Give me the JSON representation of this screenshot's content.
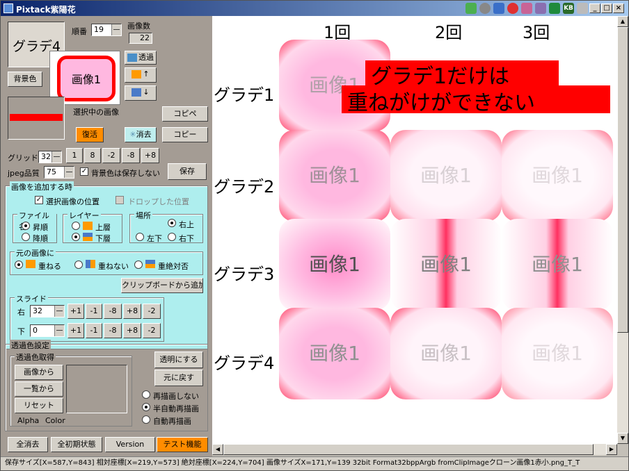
{
  "window": {
    "title": "Pixtack紫陽花"
  },
  "top": {
    "preview_name": "グラデ4",
    "order_label": "順番",
    "order_value": "19",
    "count_label": "画像数",
    "count_value": "22",
    "selected_image": "画像1",
    "transparent_btn": "透過",
    "bg_color_btn": "背景色",
    "selected_caption": "選択中の画像",
    "restore_btn": "復活",
    "erase_btn": "消去",
    "copy_paste_btn": "コピペ",
    "copy_btn": "コピー"
  },
  "grid": {
    "label": "グリッド",
    "value": "32",
    "buttons": [
      "1",
      "8",
      "-2",
      "-8",
      "+8"
    ]
  },
  "jpeg": {
    "label": "jpeg品質",
    "value": "75",
    "bg_nosave_label": "背景色は保存しない",
    "save_btn": "保存"
  },
  "add_panel": {
    "title": "画像を追加する時",
    "selected_pos_label": "選択画像の位置",
    "drop_pos_label": "ドロップした位置",
    "filename": {
      "title": "ファイル名",
      "asc": "昇順",
      "desc": "降順"
    },
    "layer": {
      "title": "レイヤー",
      "top": "上層",
      "bottom": "下層"
    },
    "place": {
      "title": "場所",
      "top_right": "右上",
      "bottom_left": "左下",
      "bottom_right": "右下"
    },
    "original": {
      "title": "元の画像に",
      "overlap": "重ねる",
      "no_overlap": "重ねない",
      "never": "重絶対否"
    },
    "clipboard_btn": "クリップボードから追加",
    "slide": {
      "title": "スライド",
      "right_label": "右",
      "right_value": "32",
      "down_label": "下",
      "down_value": "0",
      "buttons": [
        "+1",
        "-1",
        "-8",
        "+8",
        "-2"
      ]
    }
  },
  "trans_panel": {
    "title": "透過色設定",
    "get_title": "透過色取得",
    "from_image_btn": "画像から",
    "from_list_btn": "一覧から",
    "reset_btn": "リセット",
    "alpha_label": "Alpha",
    "color_label": "Color",
    "make_transparent_btn": "透明にする",
    "revert_btn": "元に戻す",
    "redraw_none": "再描画しない",
    "redraw_semi": "半自動再描画",
    "redraw_auto": "自動再描画"
  },
  "bottom_tabs": {
    "clear_all": "全消去",
    "initial_state": "全初期状態",
    "version": "Version",
    "test": "テスト機能"
  },
  "canvas": {
    "col_headers": [
      "1回",
      "2回",
      "3回"
    ],
    "row_headers": [
      "グラデ1",
      "グラデ2",
      "グラデ3",
      "グラデ4"
    ],
    "cell_text": "画像1",
    "annotation_line1": "グラデ1だけは",
    "annotation_line2": "重ねがけができない"
  },
  "status": {
    "text": "保存サイズ[X=587,Y=843] 相対座標[X=219,Y=573] 絶対座標[X=224,Y=704] 画像サイズX=171,Y=139 32bit Format32bppArgb fromClipImageクローン画像1赤小.png_T_T"
  },
  "colors": {
    "accent_orange": "#ff8c00",
    "red": "#ff0000",
    "pink": "#ffb8e0",
    "panel_cyan": "#aeeeee"
  }
}
